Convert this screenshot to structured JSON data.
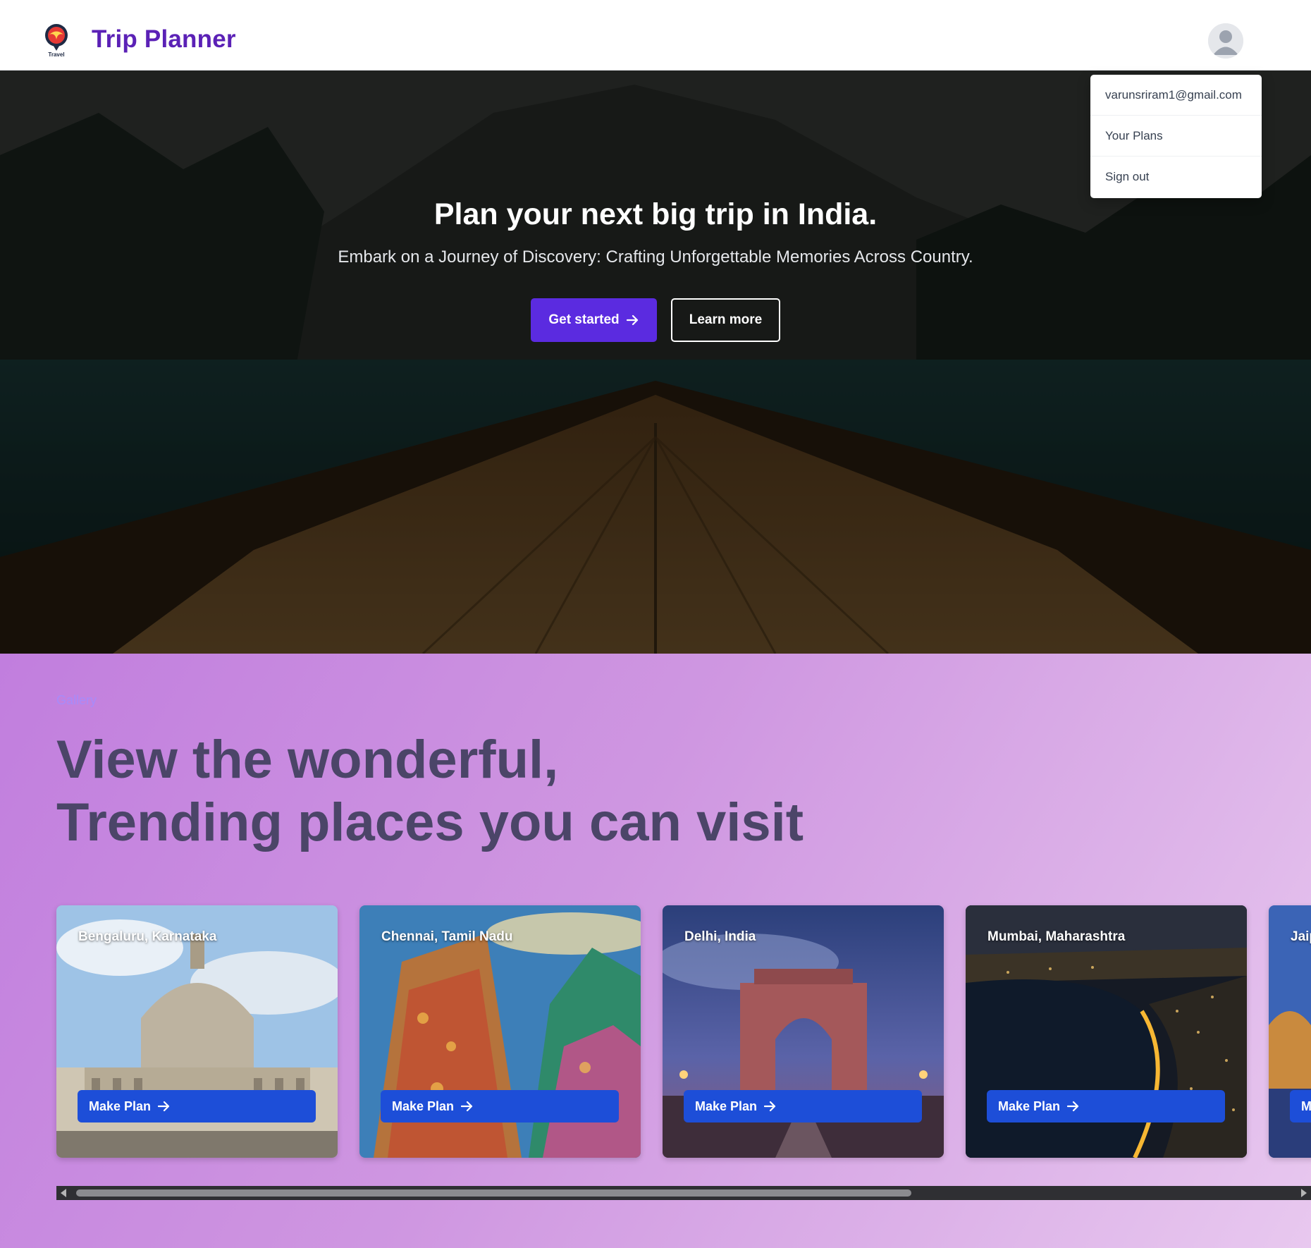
{
  "header": {
    "logo_text": "Travel",
    "brand": "Trip Planner"
  },
  "user_menu": {
    "email": "varunsriram1@gmail.com",
    "items": [
      {
        "label": "Your Plans"
      },
      {
        "label": "Sign out"
      }
    ]
  },
  "hero": {
    "title": "Plan your next big trip in India.",
    "subtitle": "Embark on a Journey of Discovery: Crafting Unforgettable Memories Across Country.",
    "primary_button": "Get started",
    "secondary_button": "Learn more"
  },
  "gallery": {
    "label": "Gallery",
    "title_line1": "View the wonderful,",
    "title_line2": "Trending places you can visit",
    "cards": [
      {
        "title": "Bengaluru, Karnataka",
        "button": "Make Plan"
      },
      {
        "title": "Chennai, Tamil Nadu",
        "button": "Make Plan"
      },
      {
        "title": "Delhi, India",
        "button": "Make Plan"
      },
      {
        "title": "Mumbai, Maharashtra",
        "button": "Make Plan"
      },
      {
        "title": "Jaip",
        "button": "M"
      }
    ]
  },
  "colors": {
    "brand": "#5b21b6",
    "primary_button": "#5b2be0",
    "make_plan_button": "#1d4ed8",
    "gallery_label": "#a78bfa",
    "gallery_title": "#4b4568"
  },
  "icons": [
    "logo-icon",
    "user-avatar-icon",
    "arrow-right-icon"
  ]
}
